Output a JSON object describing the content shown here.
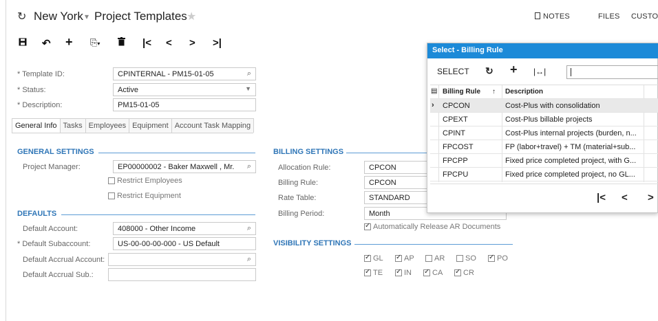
{
  "header": {
    "refresh_icon": "refresh-icon",
    "company": "New York",
    "title": "Project Templates",
    "links": [
      "NOTES",
      "FILES",
      "CUSTO"
    ]
  },
  "toolbar": {
    "icons": [
      "save-icon",
      "undo-icon",
      "add-icon",
      "copy-paste-icon",
      "delete-icon",
      "first-icon",
      "prev-icon",
      "next-icon",
      "last-icon"
    ]
  },
  "form": {
    "template_id_label": "* Template ID:",
    "template_id_value": "CPINTERNAL - PM15-01-05",
    "status_label": "* Status:",
    "status_value": "Active",
    "description_label": "* Description:",
    "description_value": "PM15-01-05"
  },
  "tabs": [
    "General Info",
    "Tasks",
    "Employees",
    "Equipment",
    "Account Task Mapping"
  ],
  "general": {
    "section": "GENERAL SETTINGS",
    "pm_label": "Project Manager:",
    "pm_value": "EP00000002 - Baker Maxwell , Mr.",
    "restrict_employees": "Restrict Employees",
    "restrict_equipment": "Restrict Equipment"
  },
  "defaults": {
    "section": "DEFAULTS",
    "account_label": "Default Account:",
    "account_value": "408000 - Other Income",
    "subaccount_label": "* Default Subaccount:",
    "subaccount_value": "US-00-00-00-000 - US Default",
    "accrual_account_label": "Default Accrual Account:",
    "accrual_account_value": "",
    "accrual_sub_label": "Default Accrual Sub.:",
    "accrual_sub_value": ""
  },
  "billing": {
    "section": "BILLING SETTINGS",
    "allocation_label": "Allocation Rule:",
    "allocation_value": "CPCON",
    "billing_rule_label": "Billing Rule:",
    "billing_rule_value": "CPCON",
    "rate_table_label": "Rate Table:",
    "rate_table_value": "STANDARD",
    "period_label": "Billing Period:",
    "period_value": "Month",
    "auto_release": "Automatically Release AR Documents"
  },
  "visibility": {
    "section": "VISIBILITY SETTINGS",
    "row1": [
      {
        "label": "GL",
        "checked": true
      },
      {
        "label": "AP",
        "checked": true
      },
      {
        "label": "AR",
        "checked": false
      },
      {
        "label": "SO",
        "checked": false
      },
      {
        "label": "PO",
        "checked": true
      }
    ],
    "row2": [
      {
        "label": "TE",
        "checked": true
      },
      {
        "label": "IN",
        "checked": true
      },
      {
        "label": "CA",
        "checked": true
      },
      {
        "label": "CR",
        "checked": true
      }
    ]
  },
  "popup": {
    "title": "Select - Billing Rule",
    "select_label": "SELECT",
    "columns": [
      "Billing Rule",
      "Description"
    ],
    "rows": [
      {
        "rule": "CPCON",
        "description": "Cost-Plus with consolidation"
      },
      {
        "rule": "CPEXT",
        "description": "Cost-Plus billable projects"
      },
      {
        "rule": "CPINT",
        "description": "Cost-Plus internal projects (burden, n..."
      },
      {
        "rule": "FPCOST",
        "description": "FP (labor+travel) + TM (material+sub..."
      },
      {
        "rule": "FPCPP",
        "description": "Fixed price completed project, with G..."
      },
      {
        "rule": "FPCPU",
        "description": "Fixed price completed project, no GL..."
      }
    ]
  }
}
